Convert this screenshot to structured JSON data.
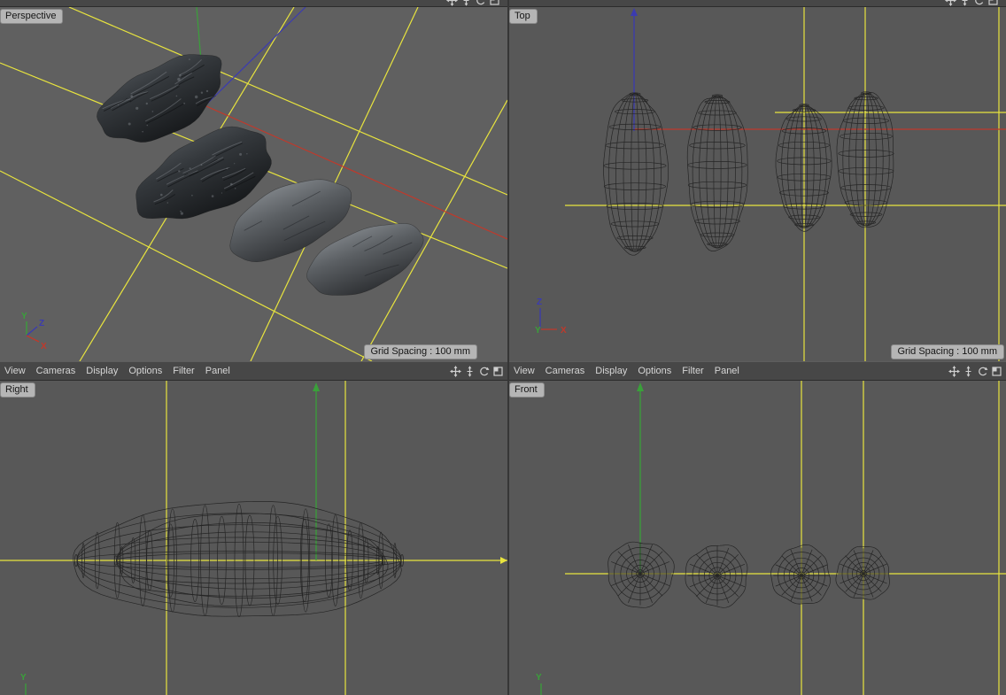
{
  "viewport_labels": {
    "perspective": "Perspective",
    "top": "Top",
    "right": "Right",
    "front": "Front"
  },
  "grid_spacing_label": "Grid Spacing : 100 mm",
  "menu_items": [
    "View",
    "Cameras",
    "Display",
    "Options",
    "Filter",
    "Panel"
  ],
  "axis_labels": {
    "x": "X",
    "y": "Y",
    "z": "Z"
  },
  "toolbar_icons": [
    {
      "name": "pan-icon"
    },
    {
      "name": "zoom-icon"
    },
    {
      "name": "rotate-icon"
    },
    {
      "name": "maximize-icon"
    }
  ],
  "colors": {
    "viewport_bg": "#585858",
    "perspective_bg": "#606060",
    "menubar_bg": "#474747",
    "menu_text": "#d6d6d6",
    "badge_bg": "#b5b5b5",
    "badge_text": "#161616",
    "grid_yellow": "#e8e43e",
    "axis_red": "#c0392b",
    "axis_green": "#3aa03a",
    "axis_blue": "#3b3bb0",
    "wireframe": "#232323"
  }
}
